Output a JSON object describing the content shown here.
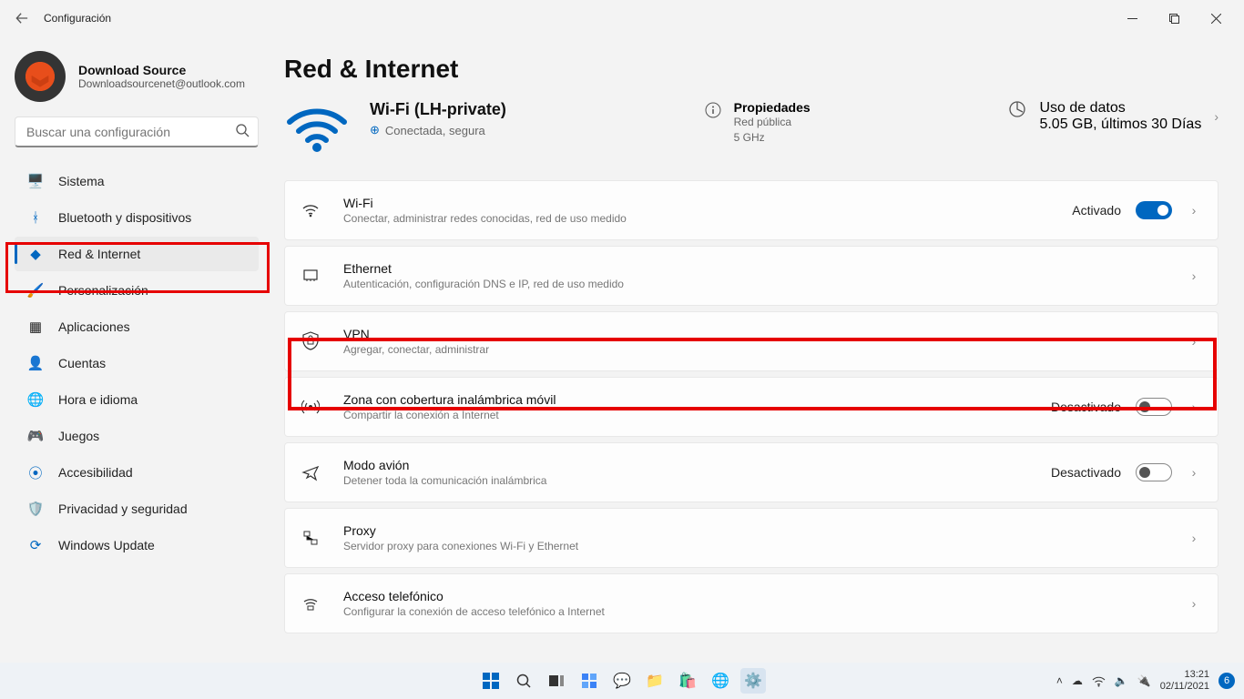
{
  "titlebar": {
    "title": "Configuración"
  },
  "account": {
    "name": "Download Source",
    "email": "Downloadsourcenet@outlook.com"
  },
  "search": {
    "placeholder": "Buscar una configuración"
  },
  "nav": [
    {
      "label": "Sistema"
    },
    {
      "label": "Bluetooth y dispositivos"
    },
    {
      "label": "Red & Internet"
    },
    {
      "label": "Personalización"
    },
    {
      "label": "Aplicaciones"
    },
    {
      "label": "Cuentas"
    },
    {
      "label": "Hora e idioma"
    },
    {
      "label": "Juegos"
    },
    {
      "label": "Accesibilidad"
    },
    {
      "label": "Privacidad y seguridad"
    },
    {
      "label": "Windows Update"
    }
  ],
  "page": {
    "title": "Red & Internet"
  },
  "status": {
    "ssid": "Wi-Fi (LH-private)",
    "connection": "Conectada, segura",
    "properties_label": "Propiedades",
    "properties_line1": "Red pública",
    "properties_line2": "5 GHz",
    "data_label": "Uso de datos",
    "data_line": "5.05 GB, últimos 30 Días"
  },
  "cards": {
    "wifi": {
      "title": "Wi-Fi",
      "sub": "Conectar, administrar redes conocidas, red de uso medido",
      "state": "Activado"
    },
    "ethernet": {
      "title": "Ethernet",
      "sub": "Autenticación, configuración DNS e IP, red de uso medido"
    },
    "vpn": {
      "title": "VPN",
      "sub": "Agregar, conectar, administrar"
    },
    "hotspot": {
      "title": "Zona con cobertura inalámbrica móvil",
      "sub": "Compartir la conexión a Internet",
      "state": "Desactivado"
    },
    "airplane": {
      "title": "Modo avión",
      "sub": "Detener toda la comunicación inalámbrica",
      "state": "Desactivado"
    },
    "proxy": {
      "title": "Proxy",
      "sub": "Servidor proxy para conexiones Wi-Fi y Ethernet"
    },
    "dialup": {
      "title": "Acceso telefónico",
      "sub": "Configurar la conexión de acceso telefónico a Internet"
    }
  },
  "taskbar": {
    "time": "13:21",
    "date": "02/11/2021",
    "badge": "6"
  }
}
